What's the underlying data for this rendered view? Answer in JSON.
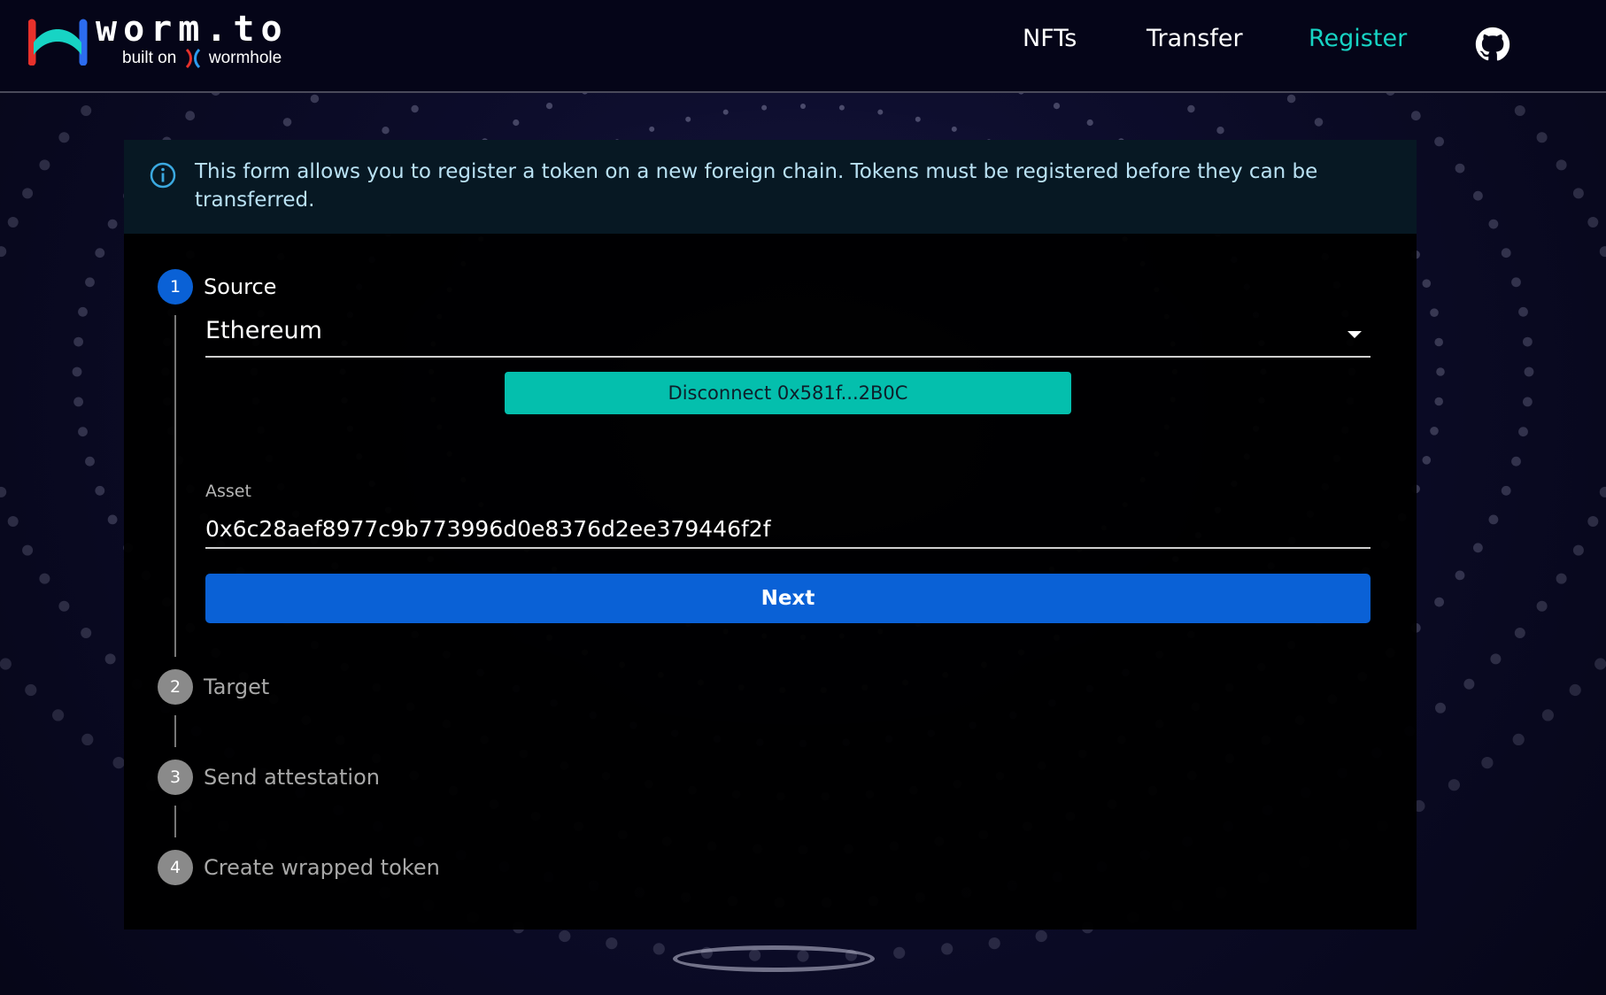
{
  "header": {
    "logo_word": "worm.to",
    "logo_sub_left": "built on",
    "logo_sub_right": "wormhole",
    "nav": [
      {
        "label": "NFTs",
        "active": false
      },
      {
        "label": "Transfer",
        "active": false
      },
      {
        "label": "Register",
        "active": true
      }
    ],
    "github_icon": "github-icon"
  },
  "info": {
    "icon": "info-icon",
    "text": "This form allows you to register a token on a new foreign chain. Tokens must be registered before they can be transferred."
  },
  "steps": [
    {
      "number": "1",
      "label": "Source",
      "active": true
    },
    {
      "number": "2",
      "label": "Target",
      "active": false
    },
    {
      "number": "3",
      "label": "Send attestation",
      "active": false
    },
    {
      "number": "4",
      "label": "Create wrapped token",
      "active": false
    }
  ],
  "source": {
    "chain_value": "Ethereum",
    "disconnect_label": "Disconnect 0x581f...2B0C",
    "asset_label": "Asset",
    "asset_value": "0x6c28aef8977c9b773996d0e8376d2ee379446f2f",
    "next_label": "Next"
  },
  "colors": {
    "accent": "#17d4c4",
    "primary": "#0a61d6",
    "disconnect": "#04bfad",
    "info_bg": "#071823"
  }
}
